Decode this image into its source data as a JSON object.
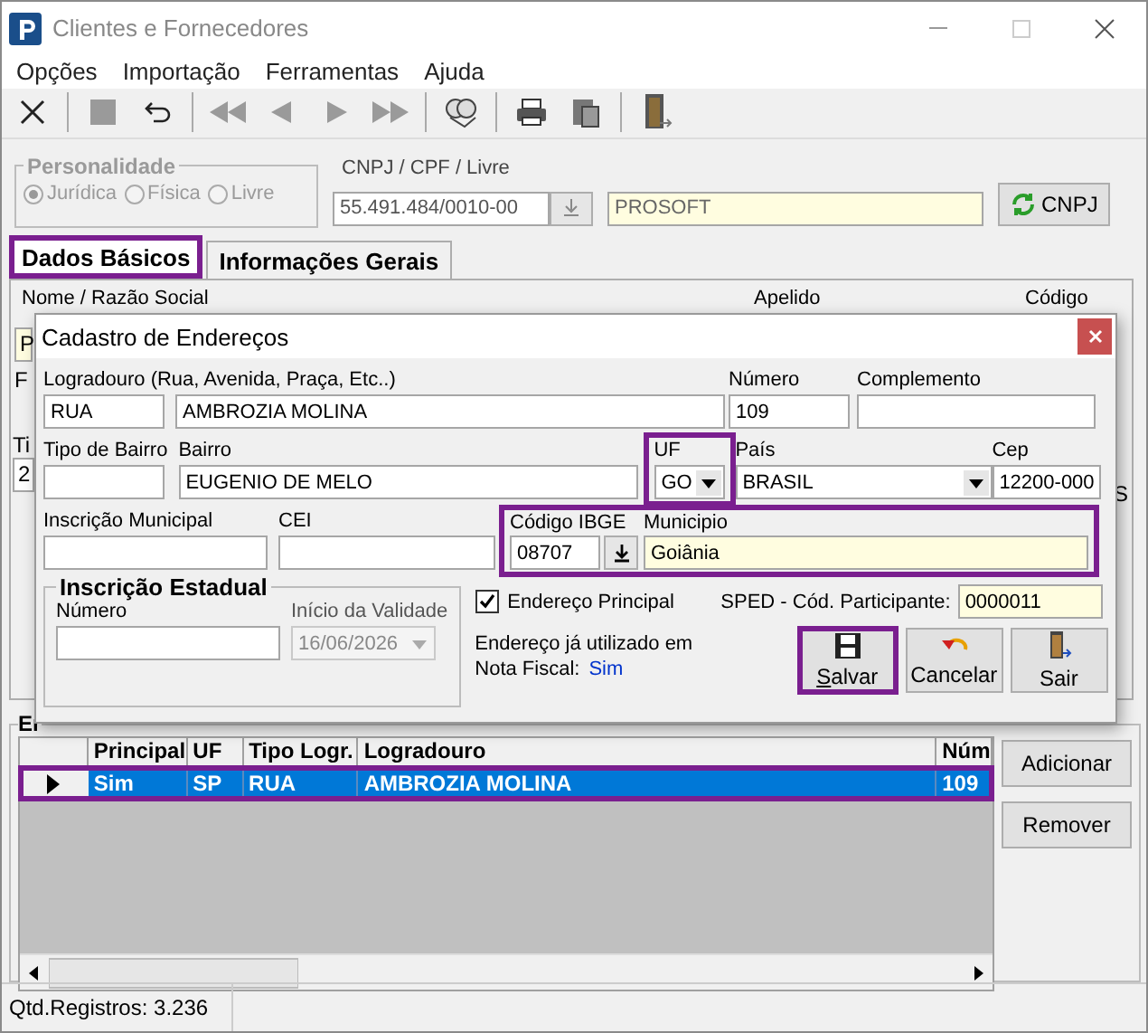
{
  "window": {
    "title": "Clientes e Fornecedores"
  },
  "menu": [
    "Opções",
    "Importação",
    "Ferramentas",
    "Ajuda"
  ],
  "personalidade": {
    "title": "Personalidade",
    "disabled": true,
    "options": [
      {
        "label": "Jurídica",
        "selected": true
      },
      {
        "label": "Física",
        "selected": false
      },
      {
        "label": "Livre",
        "selected": false
      }
    ]
  },
  "cnpj": {
    "label": "CNPJ / CPF / Livre",
    "value": "55.491.484/0010-00",
    "name_value": "PROSOFT",
    "button": "CNPJ"
  },
  "tabs": [
    {
      "label": "Dados Básicos",
      "selected": true,
      "highlighted": true
    },
    {
      "label": "Informações Gerais",
      "selected": false,
      "highlighted": false
    }
  ],
  "panel": {
    "labels": [
      "Nome / Razão Social",
      "Apelido",
      "Código"
    ],
    "covered": [
      "P",
      "F",
      "Ti",
      "2",
      "S"
    ]
  },
  "dialog": {
    "title": "Cadastro de Endereços",
    "logradouro": {
      "label": "Logradouro (Rua, Avenida, Praça, Etc..)",
      "type": "RUA",
      "value": "AMBROZIA MOLINA"
    },
    "numero": {
      "label": "Número",
      "value": "109"
    },
    "complemento": {
      "label": "Complemento"
    },
    "tipo_bairro": {
      "label": "Tipo de Bairro"
    },
    "bairro": {
      "label": "Bairro",
      "value": "EUGENIO DE MELO"
    },
    "uf": {
      "label": "UF",
      "value": "GO",
      "highlighted": true
    },
    "pais": {
      "label": "País",
      "value": "BRASIL"
    },
    "cep": {
      "label": "Cep",
      "value": "12200-000"
    },
    "inscricao_municipal": {
      "label": "Inscrição Municipal"
    },
    "cei": {
      "label": "CEI"
    },
    "ibge": {
      "label": "Código IBGE",
      "value": "08707",
      "highlighted": true
    },
    "municipio": {
      "label": "Municipio",
      "value": "Goiânia"
    },
    "inscricao_estadual": {
      "title": "Inscrição Estadual",
      "numero_label": "Número",
      "validade_label": "Início da Validade",
      "validade": "16/06/2026"
    },
    "endereco_principal": {
      "label": "Endereço Principal",
      "checked": true
    },
    "sped": {
      "label": "SPED - Cód. Participante:",
      "value": "0000011"
    },
    "usage": {
      "line1": "Endereço já utilizado em",
      "line2": "Nota Fiscal:",
      "value": "Sim"
    },
    "buttons": [
      {
        "kind": "save",
        "label": "Salvar",
        "highlighted": true
      },
      {
        "kind": "cancel",
        "label": "Cancelar",
        "highlighted": false
      },
      {
        "kind": "exit",
        "label": "Sair",
        "highlighted": false
      }
    ]
  },
  "addresses": {
    "group_label": "Er",
    "columns": [
      "Principal",
      "UF",
      "Tipo Logr.",
      "Logradouro",
      "Núm"
    ],
    "rows": [
      {
        "cells": [
          "Sim",
          "SP",
          "RUA",
          "AMBROZIA MOLINA",
          "109"
        ],
        "selected": true,
        "highlighted": true
      }
    ],
    "buttons": [
      "Adicionar",
      "Remover"
    ]
  },
  "status_bar": [
    "Qtd.Registros: 3.236"
  ]
}
